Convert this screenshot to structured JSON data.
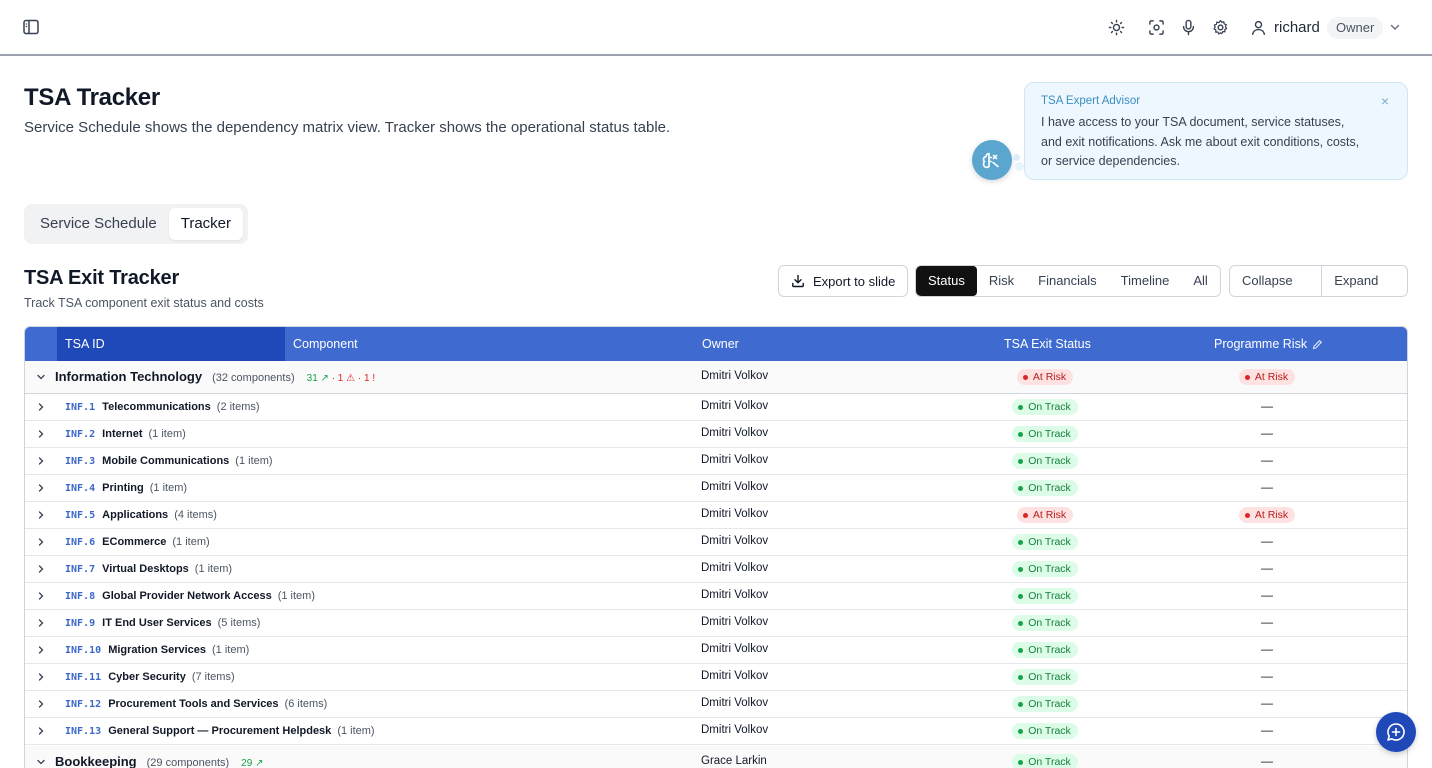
{
  "topbar": {
    "user_name": "richard",
    "role": "Owner",
    "icons": [
      "sidebar-toggle-icon",
      "theme-sun-icon",
      "screenshot-icon",
      "microphone-icon",
      "settings-gear-icon",
      "user-icon",
      "chevron-down-icon"
    ]
  },
  "page": {
    "title": "TSA Tracker",
    "description": "Service Schedule shows the dependency matrix view. Tracker shows the operational status table."
  },
  "advisor": {
    "title": "TSA Expert Advisor",
    "text": "I have access to your TSA document, service statuses, and exit notifications. Ask me about exit conditions, costs, or service dependencies.",
    "close": "×"
  },
  "view_tabs": [
    {
      "label": "Service Schedule",
      "active": false
    },
    {
      "label": "Tracker",
      "active": true
    }
  ],
  "section": {
    "title": "TSA Exit Tracker",
    "subtitle": "Track TSA component exit status and costs",
    "export_label": "Export to slide",
    "filters": [
      "Status",
      "Risk",
      "Financials",
      "Timeline",
      "All"
    ],
    "active_filter": "Status",
    "collapse_label": "Collapse All",
    "expand_label": "Expand All"
  },
  "table": {
    "headers": {
      "tsa_id": "TSA ID",
      "component": "Component",
      "owner": "Owner",
      "status": "TSA Exit Status",
      "risk": "Programme Risk"
    },
    "groups": [
      {
        "name": "Information Technology",
        "count": "(32 components)",
        "stats_ok": "31 ↗",
        "stats_risk": "· 1 ⚠ · 1 !",
        "owner": "Dmitri Volkov",
        "status": "At Risk",
        "risk": "At Risk"
      },
      {
        "name": "Bookkeeping",
        "count": "(29 components)",
        "stats_ok": "29 ↗",
        "stats_risk": "",
        "owner": "Grace Larkin",
        "status": "On Track",
        "risk": "—"
      }
    ],
    "rows": [
      {
        "id": "INF.1",
        "name": "Telecommunications",
        "count": "(2 items)",
        "owner": "Dmitri Volkov",
        "status": "On Track",
        "risk": "—"
      },
      {
        "id": "INF.2",
        "name": "Internet",
        "count": "(1 item)",
        "owner": "Dmitri Volkov",
        "status": "On Track",
        "risk": "—"
      },
      {
        "id": "INF.3",
        "name": "Mobile Communications",
        "count": "(1 item)",
        "owner": "Dmitri Volkov",
        "status": "On Track",
        "risk": "—"
      },
      {
        "id": "INF.4",
        "name": "Printing",
        "count": "(1 item)",
        "owner": "Dmitri Volkov",
        "status": "On Track",
        "risk": "—"
      },
      {
        "id": "INF.5",
        "name": "Applications",
        "count": "(4 items)",
        "owner": "Dmitri Volkov",
        "status": "At Risk",
        "risk": "At Risk"
      },
      {
        "id": "INF.6",
        "name": "ECommerce",
        "count": "(1 item)",
        "owner": "Dmitri Volkov",
        "status": "On Track",
        "risk": "—"
      },
      {
        "id": "INF.7",
        "name": "Virtual Desktops",
        "count": "(1 item)",
        "owner": "Dmitri Volkov",
        "status": "On Track",
        "risk": "—"
      },
      {
        "id": "INF.8",
        "name": "Global Provider Network Access",
        "count": "(1 item)",
        "owner": "Dmitri Volkov",
        "status": "On Track",
        "risk": "—"
      },
      {
        "id": "INF.9",
        "name": "IT End User Services",
        "count": "(5 items)",
        "owner": "Dmitri Volkov",
        "status": "On Track",
        "risk": "—"
      },
      {
        "id": "INF.10",
        "name": "Migration Services",
        "count": "(1 item)",
        "owner": "Dmitri Volkov",
        "status": "On Track",
        "risk": "—"
      },
      {
        "id": "INF.11",
        "name": "Cyber Security",
        "count": "(7 items)",
        "owner": "Dmitri Volkov",
        "status": "On Track",
        "risk": "—"
      },
      {
        "id": "INF.12",
        "name": "Procurement Tools and Services",
        "count": "(6 items)",
        "owner": "Dmitri Volkov",
        "status": "On Track",
        "risk": "—"
      },
      {
        "id": "INF.13",
        "name": "General Support — Procurement Helpdesk",
        "count": "(1 item)",
        "owner": "Dmitri Volkov",
        "status": "On Track",
        "risk": "—"
      }
    ]
  },
  "colors": {
    "header_blue": "#3f6bd1",
    "header_id_blue": "#1f49b8",
    "on_track": "#16a34a",
    "at_risk": "#dc2626",
    "advisor": "#5aa6cf"
  }
}
